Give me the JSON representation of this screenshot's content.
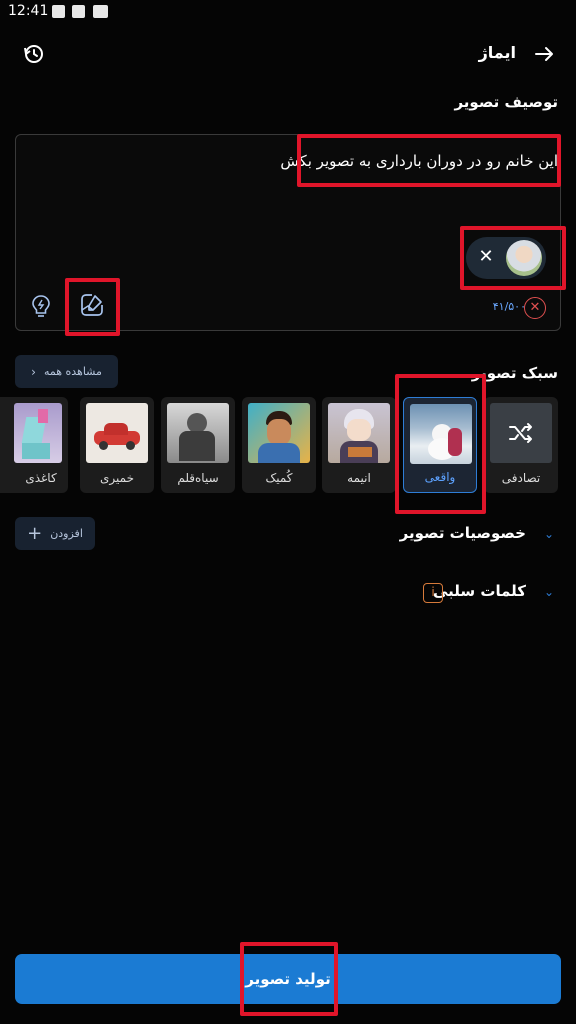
{
  "status_bar": {
    "time": "12:41"
  },
  "header": {
    "title": "ایماژ"
  },
  "prompt": {
    "section_label": "توصیف تصویر",
    "text": "این خانم رو در دوران بارداری به تصویر بکش",
    "char_count": "۴۱/۵۰۰"
  },
  "style_section": {
    "label": "سبک تصویر",
    "see_all_label": "مشاهده همه",
    "cards": [
      {
        "label": "تصادفی",
        "selected": false
      },
      {
        "label": "واقعی",
        "selected": true
      },
      {
        "label": "انیمه",
        "selected": false
      },
      {
        "label": "کُمیک",
        "selected": false
      },
      {
        "label": "سیاه‌قلم",
        "selected": false
      },
      {
        "label": "خمیری",
        "selected": false
      },
      {
        "label": "کاغذی",
        "selected": false
      }
    ]
  },
  "features": {
    "label": "خصوصیات تصویر",
    "add_label": "افزودن"
  },
  "negative": {
    "label": "کلمات سلبی"
  },
  "generate": {
    "label": "تولید تصویر"
  },
  "colors": {
    "accent": "#1b7bd3",
    "highlight": "#e0152a",
    "danger": "#e05050"
  }
}
